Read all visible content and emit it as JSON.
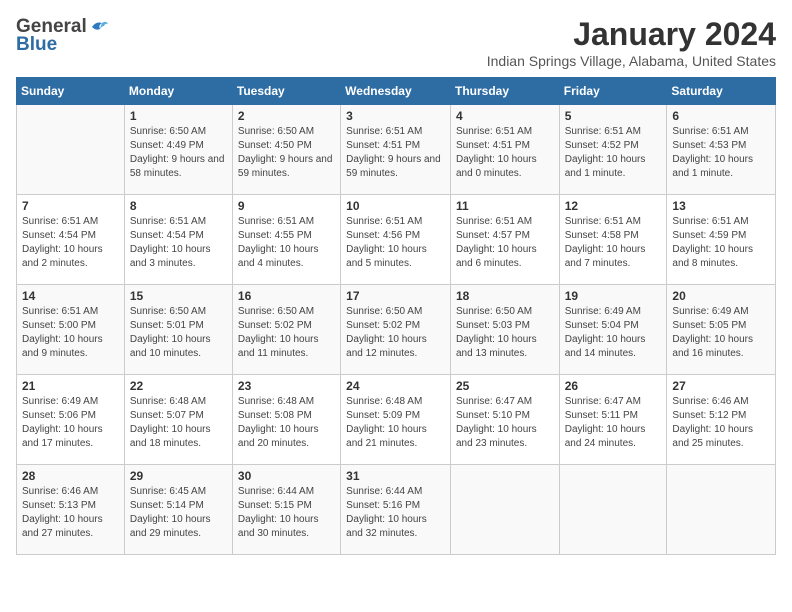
{
  "header": {
    "logo_general": "General",
    "logo_blue": "Blue",
    "month_title": "January 2024",
    "location": "Indian Springs Village, Alabama, United States"
  },
  "weekdays": [
    "Sunday",
    "Monday",
    "Tuesday",
    "Wednesday",
    "Thursday",
    "Friday",
    "Saturday"
  ],
  "weeks": [
    [
      {
        "day": "",
        "sunrise": "",
        "sunset": "",
        "daylight": ""
      },
      {
        "day": "1",
        "sunrise": "Sunrise: 6:50 AM",
        "sunset": "Sunset: 4:49 PM",
        "daylight": "Daylight: 9 hours and 58 minutes."
      },
      {
        "day": "2",
        "sunrise": "Sunrise: 6:50 AM",
        "sunset": "Sunset: 4:50 PM",
        "daylight": "Daylight: 9 hours and 59 minutes."
      },
      {
        "day": "3",
        "sunrise": "Sunrise: 6:51 AM",
        "sunset": "Sunset: 4:51 PM",
        "daylight": "Daylight: 9 hours and 59 minutes."
      },
      {
        "day": "4",
        "sunrise": "Sunrise: 6:51 AM",
        "sunset": "Sunset: 4:51 PM",
        "daylight": "Daylight: 10 hours and 0 minutes."
      },
      {
        "day": "5",
        "sunrise": "Sunrise: 6:51 AM",
        "sunset": "Sunset: 4:52 PM",
        "daylight": "Daylight: 10 hours and 1 minute."
      },
      {
        "day": "6",
        "sunrise": "Sunrise: 6:51 AM",
        "sunset": "Sunset: 4:53 PM",
        "daylight": "Daylight: 10 hours and 1 minute."
      }
    ],
    [
      {
        "day": "7",
        "sunrise": "Sunrise: 6:51 AM",
        "sunset": "Sunset: 4:54 PM",
        "daylight": "Daylight: 10 hours and 2 minutes."
      },
      {
        "day": "8",
        "sunrise": "Sunrise: 6:51 AM",
        "sunset": "Sunset: 4:54 PM",
        "daylight": "Daylight: 10 hours and 3 minutes."
      },
      {
        "day": "9",
        "sunrise": "Sunrise: 6:51 AM",
        "sunset": "Sunset: 4:55 PM",
        "daylight": "Daylight: 10 hours and 4 minutes."
      },
      {
        "day": "10",
        "sunrise": "Sunrise: 6:51 AM",
        "sunset": "Sunset: 4:56 PM",
        "daylight": "Daylight: 10 hours and 5 minutes."
      },
      {
        "day": "11",
        "sunrise": "Sunrise: 6:51 AM",
        "sunset": "Sunset: 4:57 PM",
        "daylight": "Daylight: 10 hours and 6 minutes."
      },
      {
        "day": "12",
        "sunrise": "Sunrise: 6:51 AM",
        "sunset": "Sunset: 4:58 PM",
        "daylight": "Daylight: 10 hours and 7 minutes."
      },
      {
        "day": "13",
        "sunrise": "Sunrise: 6:51 AM",
        "sunset": "Sunset: 4:59 PM",
        "daylight": "Daylight: 10 hours and 8 minutes."
      }
    ],
    [
      {
        "day": "14",
        "sunrise": "Sunrise: 6:51 AM",
        "sunset": "Sunset: 5:00 PM",
        "daylight": "Daylight: 10 hours and 9 minutes."
      },
      {
        "day": "15",
        "sunrise": "Sunrise: 6:50 AM",
        "sunset": "Sunset: 5:01 PM",
        "daylight": "Daylight: 10 hours and 10 minutes."
      },
      {
        "day": "16",
        "sunrise": "Sunrise: 6:50 AM",
        "sunset": "Sunset: 5:02 PM",
        "daylight": "Daylight: 10 hours and 11 minutes."
      },
      {
        "day": "17",
        "sunrise": "Sunrise: 6:50 AM",
        "sunset": "Sunset: 5:02 PM",
        "daylight": "Daylight: 10 hours and 12 minutes."
      },
      {
        "day": "18",
        "sunrise": "Sunrise: 6:50 AM",
        "sunset": "Sunset: 5:03 PM",
        "daylight": "Daylight: 10 hours and 13 minutes."
      },
      {
        "day": "19",
        "sunrise": "Sunrise: 6:49 AM",
        "sunset": "Sunset: 5:04 PM",
        "daylight": "Daylight: 10 hours and 14 minutes."
      },
      {
        "day": "20",
        "sunrise": "Sunrise: 6:49 AM",
        "sunset": "Sunset: 5:05 PM",
        "daylight": "Daylight: 10 hours and 16 minutes."
      }
    ],
    [
      {
        "day": "21",
        "sunrise": "Sunrise: 6:49 AM",
        "sunset": "Sunset: 5:06 PM",
        "daylight": "Daylight: 10 hours and 17 minutes."
      },
      {
        "day": "22",
        "sunrise": "Sunrise: 6:48 AM",
        "sunset": "Sunset: 5:07 PM",
        "daylight": "Daylight: 10 hours and 18 minutes."
      },
      {
        "day": "23",
        "sunrise": "Sunrise: 6:48 AM",
        "sunset": "Sunset: 5:08 PM",
        "daylight": "Daylight: 10 hours and 20 minutes."
      },
      {
        "day": "24",
        "sunrise": "Sunrise: 6:48 AM",
        "sunset": "Sunset: 5:09 PM",
        "daylight": "Daylight: 10 hours and 21 minutes."
      },
      {
        "day": "25",
        "sunrise": "Sunrise: 6:47 AM",
        "sunset": "Sunset: 5:10 PM",
        "daylight": "Daylight: 10 hours and 23 minutes."
      },
      {
        "day": "26",
        "sunrise": "Sunrise: 6:47 AM",
        "sunset": "Sunset: 5:11 PM",
        "daylight": "Daylight: 10 hours and 24 minutes."
      },
      {
        "day": "27",
        "sunrise": "Sunrise: 6:46 AM",
        "sunset": "Sunset: 5:12 PM",
        "daylight": "Daylight: 10 hours and 25 minutes."
      }
    ],
    [
      {
        "day": "28",
        "sunrise": "Sunrise: 6:46 AM",
        "sunset": "Sunset: 5:13 PM",
        "daylight": "Daylight: 10 hours and 27 minutes."
      },
      {
        "day": "29",
        "sunrise": "Sunrise: 6:45 AM",
        "sunset": "Sunset: 5:14 PM",
        "daylight": "Daylight: 10 hours and 29 minutes."
      },
      {
        "day": "30",
        "sunrise": "Sunrise: 6:44 AM",
        "sunset": "Sunset: 5:15 PM",
        "daylight": "Daylight: 10 hours and 30 minutes."
      },
      {
        "day": "31",
        "sunrise": "Sunrise: 6:44 AM",
        "sunset": "Sunset: 5:16 PM",
        "daylight": "Daylight: 10 hours and 32 minutes."
      },
      {
        "day": "",
        "sunrise": "",
        "sunset": "",
        "daylight": ""
      },
      {
        "day": "",
        "sunrise": "",
        "sunset": "",
        "daylight": ""
      },
      {
        "day": "",
        "sunrise": "",
        "sunset": "",
        "daylight": ""
      }
    ]
  ]
}
